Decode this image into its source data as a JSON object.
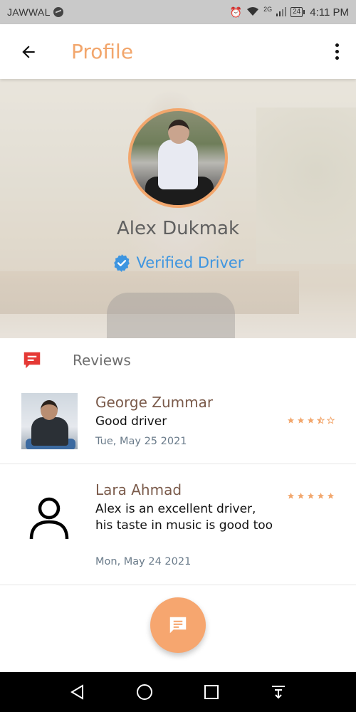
{
  "status_bar": {
    "carrier": "JAWWAL",
    "network": "2G",
    "battery": "24",
    "time": "4:11 PM"
  },
  "app_bar": {
    "title": "Profile"
  },
  "profile": {
    "name": "Alex Dukmak",
    "verified_label": "Verified Driver"
  },
  "reviews": {
    "title": "Reviews",
    "items": [
      {
        "name": "George Zummar",
        "text": "Good driver",
        "date": "Tue, May 25 2021",
        "rating": 3.5
      },
      {
        "name": "Lara Ahmad",
        "text": "Alex is an excellent driver, his taste in music is good too",
        "date": "Mon, May 24 2021",
        "rating": 5
      }
    ]
  },
  "colors": {
    "accent": "#f2a66c",
    "verified": "#3d95e0",
    "reviewer_name": "#7a5a4a",
    "reviews_icon": "#e53935"
  }
}
